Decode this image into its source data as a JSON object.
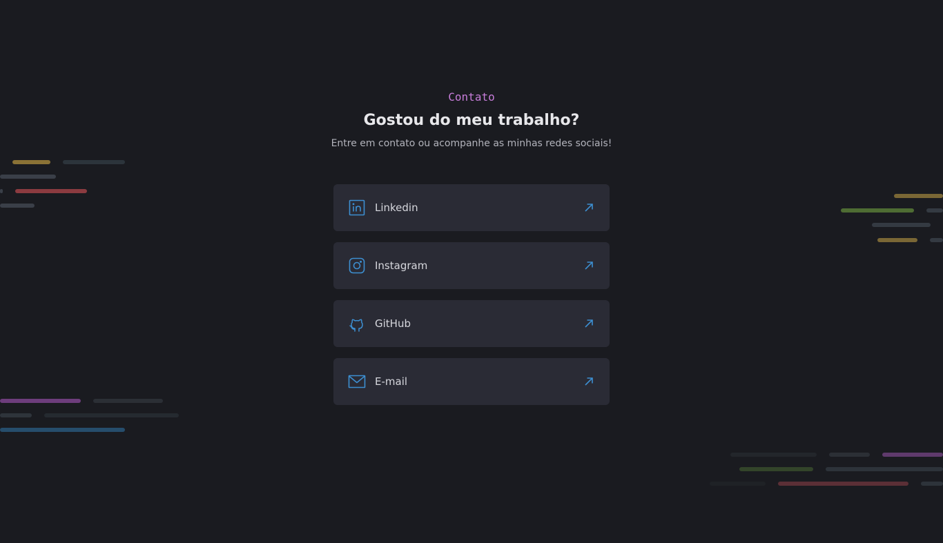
{
  "contact": {
    "tag": "Contato",
    "title": "Gostou do meu trabalho?",
    "subtitle": "Entre em contato ou acompanhe as minhas redes sociais!"
  },
  "links": [
    {
      "label": "Linkedin",
      "icon": "linkedin-icon"
    },
    {
      "label": "Instagram",
      "icon": "instagram-icon"
    },
    {
      "label": "GitHub",
      "icon": "github-icon"
    },
    {
      "label": "E-mail",
      "icon": "mail-icon"
    }
  ],
  "colors": {
    "background": "#1a1b20",
    "card": "#2a2b35",
    "accent_blue": "#3d8fd1",
    "tag_purple": "#c77dda",
    "title": "#e7e7ea",
    "text": "#b2b3bb"
  }
}
